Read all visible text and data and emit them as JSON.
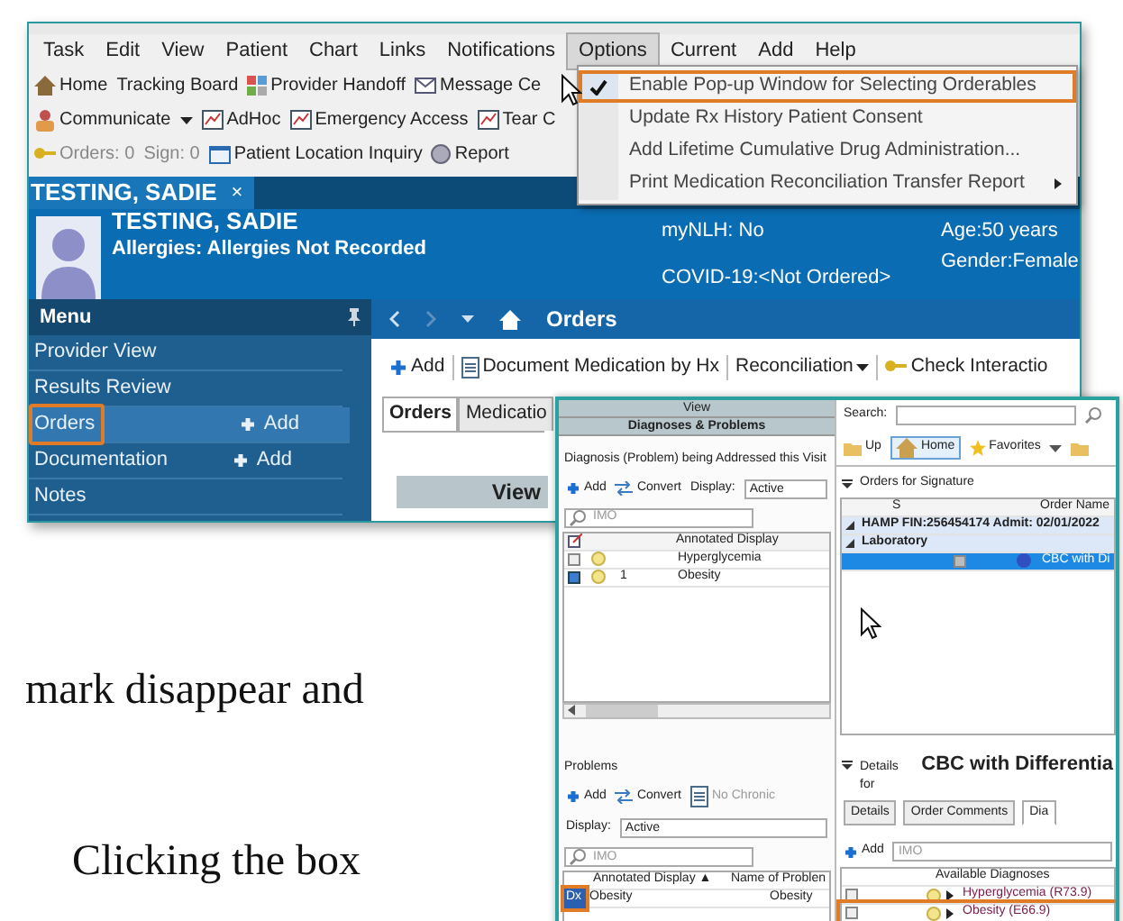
{
  "main_window": {
    "menu_bar": [
      {
        "label": "Task",
        "selected": false
      },
      {
        "label": "Edit",
        "selected": false
      },
      {
        "label": "View",
        "selected": false
      },
      {
        "label": "Patient",
        "selected": false
      },
      {
        "label": "Chart",
        "selected": false
      },
      {
        "label": "Links",
        "selected": false
      },
      {
        "label": "Notifications",
        "selected": false
      },
      {
        "label": "Options",
        "selected": true
      },
      {
        "label": "Current",
        "selected": false
      },
      {
        "label": "Add",
        "selected": false
      },
      {
        "label": "Help",
        "selected": false
      }
    ],
    "toolbar_rows": [
      [
        "Home",
        "Tracking Board",
        "Provider Handoff",
        "Message Ce"
      ],
      [
        "Communicate",
        "AdHoc",
        "Emergency Access",
        "Tear C"
      ],
      [
        "Orders: 0",
        "Sign: 0",
        "Patient Location Inquiry",
        "Report"
      ]
    ],
    "options_menu": {
      "callout": true,
      "items": [
        {
          "label": "Enable Pop-up Window for Selecting Orderables",
          "checked": true,
          "submenu": false
        },
        {
          "label": "Update Rx History Patient Consent",
          "checked": false,
          "submenu": false
        },
        {
          "label": "Add Lifetime Cumulative Drug Administration...",
          "checked": false,
          "submenu": false
        },
        {
          "label": "Print Medication Reconciliation Transfer Report",
          "checked": false,
          "submenu": true
        }
      ]
    },
    "patient_tab": {
      "label": "TESTING, SADIE",
      "close": "×"
    },
    "banner": {
      "name": "TESTING, SADIE",
      "allergies": "Allergies: Allergies Not Recorded",
      "nlh": "myNLH: No",
      "covid": "COVID-19:<Not Ordered>",
      "age": "Age:50 years",
      "gender": "Gender:Female"
    },
    "side_menu": {
      "title": "Menu",
      "items": [
        {
          "label": "Provider View",
          "selected": false,
          "callout": false
        },
        {
          "label": "Results Review",
          "selected": false,
          "callout": false
        },
        {
          "label": "Orders",
          "selected": true,
          "callout": true,
          "add": "Add"
        },
        {
          "label": "Documentation",
          "selected": false,
          "callout": false,
          "add": "Add"
        },
        {
          "label": "Notes",
          "selected": false,
          "callout": false
        }
      ]
    },
    "content": {
      "page_title": "Orders",
      "toolbar": [
        "Add",
        "Document Medication by Hx",
        "Reconciliation",
        "Check Interactio"
      ],
      "tabs": [
        {
          "label": "Orders",
          "selected": true
        },
        {
          "label": "Medicatio",
          "selected": false
        }
      ],
      "table_header": "View"
    }
  },
  "document_text": [
    "mark disappear and",
    "Clicking the box"
  ],
  "orders_window": {
    "diagnoses": {
      "view_label": "View",
      "title": "Diagnoses & Problems",
      "group_label": "Diagnosis (Problem) being Addressed this Visit",
      "toolbar": [
        "Add",
        "Convert"
      ],
      "display_label": "Display:",
      "display_value": "Active",
      "search_placeholder": "IMO",
      "column": "Annotated Display",
      "rows": [
        {
          "checked": false,
          "number": "",
          "label": "Hyperglycemia"
        },
        {
          "checked": true,
          "number": "1",
          "label": "Obesity"
        }
      ]
    },
    "problems": {
      "title": "Problems",
      "toolbar": [
        "Add",
        "Convert",
        "No Chronic"
      ],
      "display_label": "Display:",
      "display_value": "Active",
      "search_placeholder": "IMO",
      "columns": [
        "Annotated Display ▲",
        "Name of Problen"
      ],
      "rows": [
        {
          "marker": "Dx",
          "callout": true,
          "cells": [
            "Obesity",
            "Obesity"
          ]
        }
      ]
    },
    "orders": {
      "search_label": "Search:",
      "nav": [
        {
          "label": "Up",
          "selected": false
        },
        {
          "label": "Home",
          "selected": true
        },
        {
          "label": "Favorites",
          "selected": false
        }
      ],
      "section_title": "Orders for Signature",
      "columns": [
        "S",
        "Order Name"
      ],
      "rows": [
        {
          "kind": "group",
          "label": "HAMP FIN:256454174 Admit: 02/01/2022",
          "selected": false
        },
        {
          "kind": "group",
          "label": "Laboratory",
          "selected": false
        },
        {
          "kind": "order",
          "label": "CBC with Di",
          "selected": true
        }
      ]
    },
    "details": {
      "prefix": "Details for",
      "order": "CBC with Differentia",
      "tabs": [
        {
          "label": "Details",
          "selected": false
        },
        {
          "label": "Order Comments",
          "selected": false
        },
        {
          "label": "Dia",
          "selected": true
        }
      ],
      "add": "Add",
      "search_placeholder": "IMO",
      "column": "Available Diagnoses",
      "rows": [
        {
          "label": "Hyperglycemia (R73.9)",
          "checked": false,
          "callout": false
        },
        {
          "label": "Obesity (E66.9)",
          "checked": false,
          "callout": true
        }
      ]
    }
  }
}
